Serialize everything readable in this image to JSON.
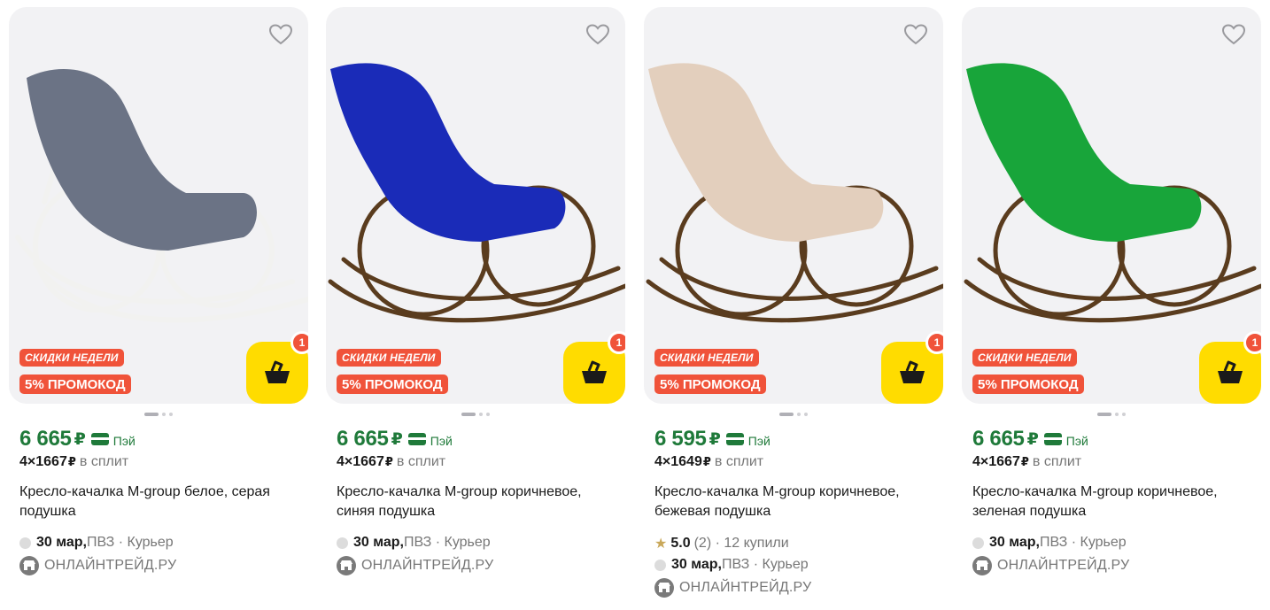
{
  "products": [
    {
      "badge_week": "СКИДКИ НЕДЕЛИ",
      "badge_promo": "5% ПРОМОКОД",
      "cart_count": "1",
      "price": "6 665",
      "currency": "₽",
      "pay_label": "Пэй",
      "split_value": "4×1667",
      "split_currency": "₽",
      "split_label": "в сплит",
      "title": "Кресло-качалка M-group белое, серая подушка",
      "rating": null,
      "delivery_date": "30 мар,",
      "delivery_rest": " ПВЗ · Курьер",
      "shop": "ОНЛАЙНТРЕЙД.РУ",
      "cushion_color": "#6b7385",
      "frame_color": "#f2f2f0"
    },
    {
      "badge_week": "СКИДКИ НЕДЕЛИ",
      "badge_promo": "5% ПРОМОКОД",
      "cart_count": "1",
      "price": "6 665",
      "currency": "₽",
      "pay_label": "Пэй",
      "split_value": "4×1667",
      "split_currency": "₽",
      "split_label": "в сплит",
      "title": "Кресло-качалка M-group коричневое, синяя подушка",
      "rating": null,
      "delivery_date": "30 мар,",
      "delivery_rest": " ПВЗ · Курьер",
      "shop": "ОНЛАЙНТРЕЙД.РУ",
      "cushion_color": "#1a2bb8",
      "frame_color": "#5a3c1e"
    },
    {
      "badge_week": "СКИДКИ НЕДЕЛИ",
      "badge_promo": "5% ПРОМОКОД",
      "cart_count": "1",
      "price": "6 595",
      "currency": "₽",
      "pay_label": "Пэй",
      "split_value": "4×1649",
      "split_currency": "₽",
      "split_label": "в сплит",
      "title": "Кресло-качалка M-group коричневое, бежевая подушка",
      "rating": {
        "value": "5.0",
        "rest": "(2) · 12 купили"
      },
      "delivery_date": "30 мар,",
      "delivery_rest": " ПВЗ · Курьер",
      "shop": "ОНЛАЙНТРЕЙД.РУ",
      "cushion_color": "#e3cfbd",
      "frame_color": "#5a3c1e"
    },
    {
      "badge_week": "СКИДКИ НЕДЕЛИ",
      "badge_promo": "5% ПРОМОКОД",
      "cart_count": "1",
      "price": "6 665",
      "currency": "₽",
      "pay_label": "Пэй",
      "split_value": "4×1667",
      "split_currency": "₽",
      "split_label": "в сплит",
      "title": "Кресло-качалка M-group коричневое, зеленая подушка",
      "rating": null,
      "delivery_date": "30 мар,",
      "delivery_rest": " ПВЗ · Курьер",
      "shop": "ОНЛАЙНТРЕЙД.РУ",
      "cushion_color": "#18a53a",
      "frame_color": "#5a3c1e"
    }
  ],
  "colors": {
    "accent_green": "#1f7a3a",
    "badge_red": "#f0533a",
    "cart_yellow": "#ffdc00"
  }
}
